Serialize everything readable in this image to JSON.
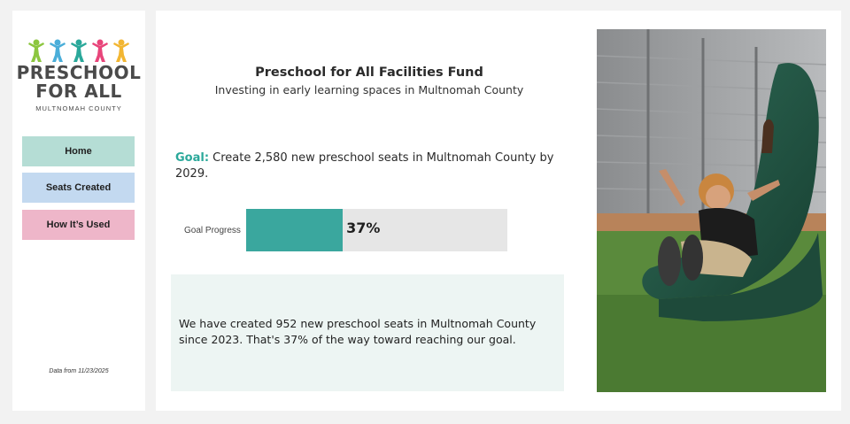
{
  "sidebar": {
    "logo": {
      "line1": "PRESCHOOL",
      "line2": "FOR ALL",
      "sub": "MULTNOMAH COUNTY",
      "figure_colors": [
        "#8cc63f",
        "#4aaed9",
        "#2aa89a",
        "#e8457a",
        "#f2b632"
      ]
    },
    "nav": {
      "home": "Home",
      "seats_created": "Seats Created",
      "how_used": "How It’s Used"
    },
    "data_date": "Data from 11/23/2025"
  },
  "main": {
    "title": "Preschool for All Facilities Fund",
    "subtitle": "Investing in early learning spaces in Multnomah County",
    "goal": {
      "label": "Goal:",
      "text": " Create 2,580 new preschool seats in Multnomah County by 2029."
    },
    "progress": {
      "label": "Goal Progress",
      "value_text": "37%",
      "fraction": 0.37,
      "fill_color": "#3aa79e",
      "track_color": "#e6e6e6"
    },
    "summary": "We have created 952 new preschool seats in Multnomah County since 2023. That's 37% of the way toward reaching our goal.",
    "photo": {
      "icon": "photo-child-on-slide"
    }
  }
}
